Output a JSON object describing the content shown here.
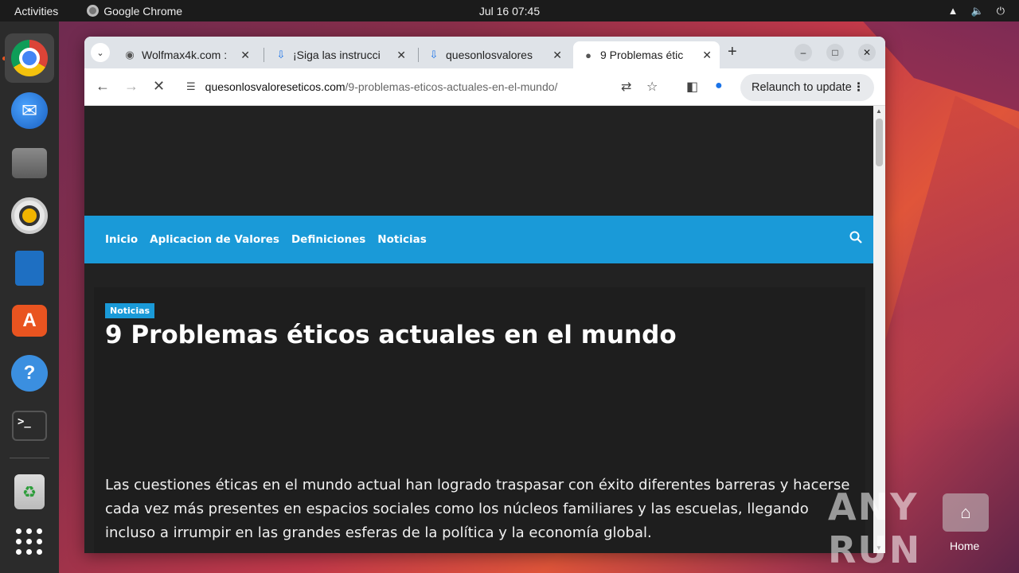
{
  "topbar": {
    "activities": "Activities",
    "app_name": "Google Chrome",
    "clock": "Jul 16  07:45"
  },
  "dock": {
    "items": [
      "chrome",
      "thunderbird",
      "files",
      "rhythmbox",
      "libreoffice-writer",
      "app-center",
      "help",
      "terminal",
      "trash",
      "show-apps"
    ]
  },
  "browser": {
    "tabs": [
      {
        "title": "Wolfmax4k.com :",
        "favicon": "globe-icon"
      },
      {
        "title": "¡Siga las instrucci",
        "favicon": "download-icon"
      },
      {
        "title": "quesonlosvalores",
        "favicon": "download-icon"
      },
      {
        "title": "9 Problemas étic",
        "favicon": "site-icon",
        "active": true
      }
    ],
    "url_host": "quesonlosvaloreseticos.com",
    "url_path": "/9-problemas-eticos-actuales-en-el-mundo/",
    "relaunch_label": "Relaunch to update"
  },
  "page": {
    "nav": [
      "Inicio",
      "Aplicacion de Valores",
      "Definiciones",
      "Noticias"
    ],
    "category_badge": "Noticias",
    "headline": "9 Problemas éticos actuales en el mundo",
    "paragraph": "Las cuestiones éticas en el mundo actual han logrado traspasar con éxito diferentes barreras y hacerse cada vez más presentes en espacios sociales como los núcleos familiares y las escuelas, llegando incluso a irrumpir en las grandes esferas de la política y la economía global."
  },
  "desktop": {
    "watermark": "ANY RUN",
    "home_label": "Home"
  },
  "colors": {
    "nav_blue": "#1a9ad8",
    "page_bg": "#222222",
    "ubuntu_orange": "#e95420"
  }
}
